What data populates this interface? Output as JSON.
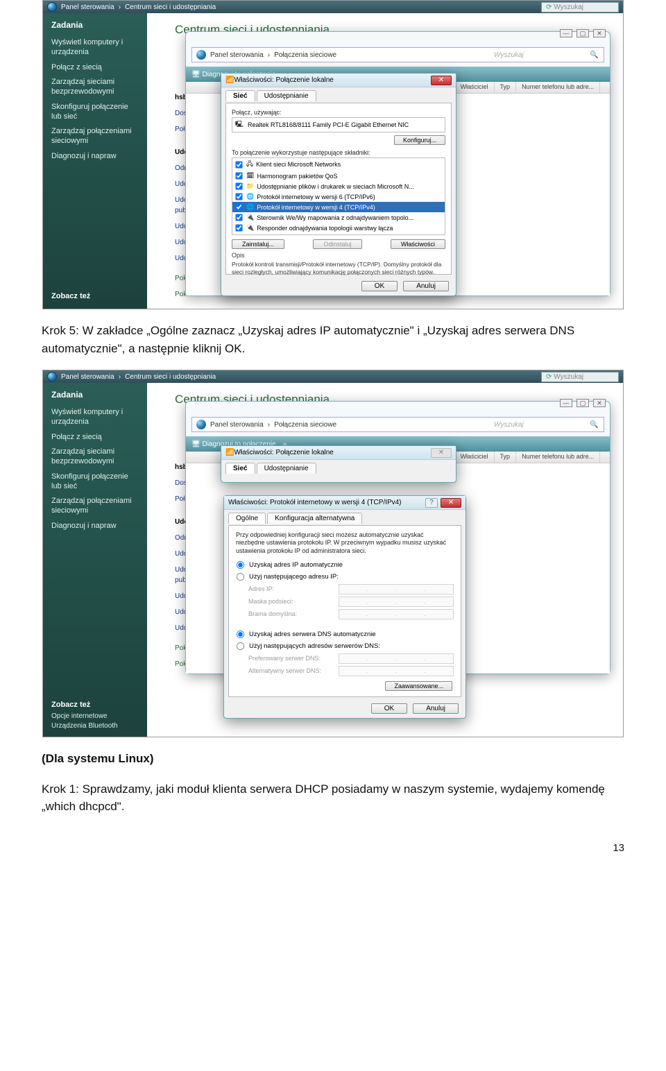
{
  "doc": {
    "step5_text": "Krok 5: W zakładce „Ogólne zaznacz „Uzyskaj adres IP automatycznie\" i „Uzyskaj adres serwera DNS automatycznie\", a następnie kliknij OK.",
    "linux_header": "(Dla systemu Linux)",
    "linux_step1": "Krok 1: Sprawdzamy, jaki moduł klienta serwera DHCP posiadamy w naszym systemie, wydajemy komendę „which dhcpcd\".",
    "page_number": "13"
  },
  "top_breadcrumb": {
    "item1": "Panel sterowania",
    "item2": "Centrum sieci i udostępniania",
    "search_placeholder": "Wyszukaj"
  },
  "sidebar": {
    "header": "Zadania",
    "items": [
      {
        "label": "Wyświetl komputery i urządzenia"
      },
      {
        "label": "Połącz z siecią"
      },
      {
        "label": "Zarządzaj sieciami bezprzewodowymi"
      },
      {
        "label": "Skonfiguruj połączenie lub sieć"
      },
      {
        "label": "Zarządzaj połączeniami sieciowymi"
      },
      {
        "label": "Diagnozuj i napraw"
      }
    ],
    "see_also": "Zobacz też",
    "opt1": "Opcje internetowe",
    "opt2": "Urządzenia Bluetooth"
  },
  "main": {
    "title": "Centrum sieci i udostępniania",
    "hsb_label": "hsb",
    "behind_access": "Dostęp",
    "behind_connect": "Połącze",
    "behind_udo_header": "Udo",
    "behind_items": [
      "Odnajdo",
      "Udostęp",
      "Udostęp",
      "publiczn",
      "Udostęp",
      "Udostęp",
      "Udostęp"
    ],
    "behind_showme1": "Pokaż w",
    "behind_showme2": "Pokaż w"
  },
  "subwin": {
    "addr_item1": "Panel sterowania",
    "addr_item2": "Połączenia sieciowe",
    "addr_search": "Wyszukaj",
    "toolbar": {
      "diagnose": "Diagnozuj to połączenie",
      "more": "»"
    },
    "columns": {
      "gorja": "goria sieci",
      "owner": "Właściciel",
      "type": "Typ",
      "phone": "Numer telefonu lub adre..."
    }
  },
  "propdlg": {
    "title": "Właściwości: Połączenie lokalne",
    "tab_net": "Sieć",
    "tab_share": "Udostępnianie",
    "connect_using": "Połącz, używając:",
    "adapter": "Realtek RTL8168/8111 Family PCI-E Gigabit Ethernet NIC",
    "configure": "Konfiguruj...",
    "uses_label": "To połączenie wykorzystuje następujące składniki:",
    "components": [
      "Klient sieci Microsoft Networks",
      "Harmonogram pakietów QoS",
      "Udostępnianie plików i drukarek w sieciach Microsoft N...",
      "Protokół internetowy w wersji 6 (TCP/IPv6)",
      "Protokół internetowy w wersji 4 (TCP/IPv4)",
      "Sterownik We/Wy mapowania z odnajdywaniem topolo...",
      "Responder odnajdywania topologii warstwy łącza"
    ],
    "btn_install": "Zainstaluj...",
    "btn_uninstall": "Odinstaluj",
    "btn_props": "Właściwości",
    "desc_header": "Opis",
    "desc_text": "Protokół kontroli transmisji/Protokół internetowy (TCP/IP). Domyślny protokół dla sieci rozległych, umożliwiający komunikację połączonych sieci różnych typów.",
    "btn_ok": "OK",
    "btn_cancel": "Anuluj"
  },
  "ipdlg": {
    "title": "Właściwości: Protokół internetowy w wersji 4 (TCP/IPv4)",
    "tab_general": "Ogólne",
    "tab_alt": "Konfiguracja alternatywna",
    "intro": "Przy odpowiedniej konfiguracji sieci możesz automatycznie uzyskać niezbędne ustawienia protokołu IP. W przeciwnym wypadku musisz uzyskać ustawienia protokołu IP od administratora sieci.",
    "radio_auto_ip": "Uzyskaj adres IP automatycznie",
    "radio_manual_ip": "Użyj następującego adresu IP:",
    "field_ip": "Adres IP:",
    "field_mask": "Maska podsieci:",
    "field_gw": "Brama domyślna:",
    "radio_auto_dns": "Uzyskaj adres serwera DNS automatycznie",
    "radio_manual_dns": "Użyj następujących adresów serwerów DNS:",
    "field_pref_dns": "Preferowany serwer DNS:",
    "field_alt_dns": "Alternatywny serwer DNS:",
    "btn_adv": "Zaawansowane...",
    "btn_ok": "OK",
    "btn_cancel": "Anuluj"
  }
}
